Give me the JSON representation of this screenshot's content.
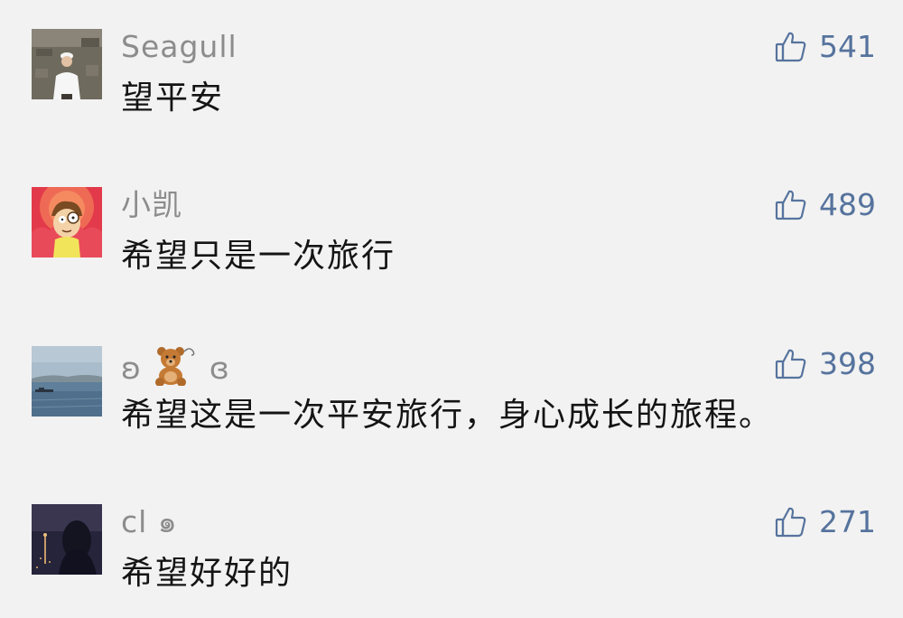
{
  "comments": [
    {
      "user": "Seagull",
      "text": "望平安",
      "likes": "541",
      "avatar_icon": "user-photo-white-hat"
    },
    {
      "user": "小凯",
      "text": "希望只是一次旅行",
      "likes": "489",
      "avatar_icon": "cartoon-boy-avatar"
    },
    {
      "user_prefix": "ʚ",
      "user_emoji": "🧸",
      "user_suffix": "ɞ",
      "text": "希望这是一次平安旅行，身心成长的旅程。",
      "likes": "398",
      "avatar_icon": "sea-landscape-avatar"
    },
    {
      "user": "cl ๑",
      "text": "希望好好的",
      "likes": "271",
      "avatar_icon": "dark-night-avatar"
    }
  ],
  "colors": {
    "background": "#f2f2f2",
    "username": "#8c8c8c",
    "text": "#141414",
    "like": "#56739d"
  }
}
